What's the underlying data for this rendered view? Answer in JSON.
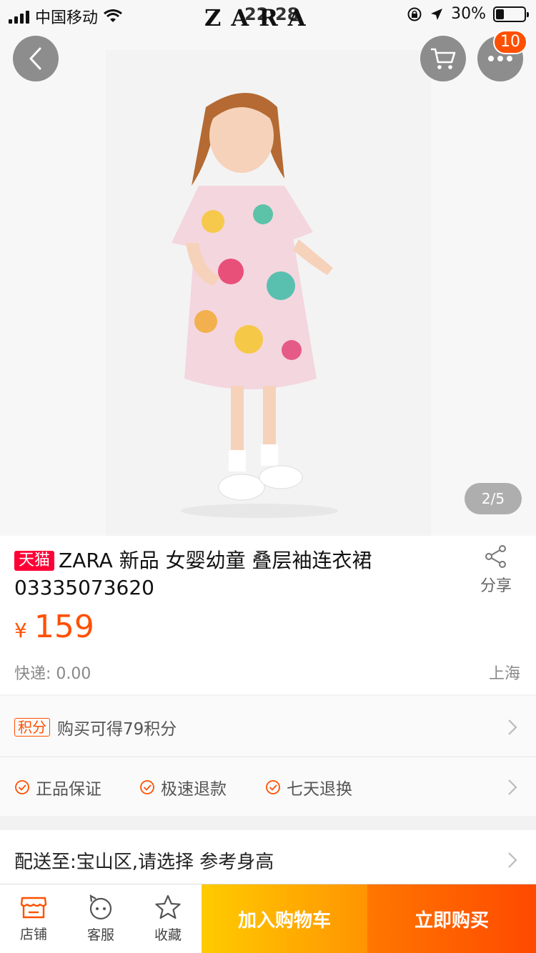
{
  "status_bar": {
    "carrier": "中国移动",
    "brand": "ZARA",
    "time": "22:28",
    "battery_percent_text": "30%",
    "battery_level": 0.3
  },
  "header": {
    "cart_badge": "10"
  },
  "gallery": {
    "pager": "2/5"
  },
  "product": {
    "tag": "天猫",
    "title": "ZARA 新品 女婴幼童 叠层袖连衣裙 03335073620",
    "share_label": "分享",
    "currency": "¥",
    "price": "159",
    "shipping": "快递: 0.00",
    "location": "上海"
  },
  "services": {
    "points_tag": "积分",
    "points_text": "购买可得79积分",
    "guarantees": [
      "正品保证",
      "极速退款",
      "七天退换"
    ]
  },
  "delivery": {
    "text": "配送至:宝山区,请选择 参考身高"
  },
  "bottom_bar": {
    "store": "店铺",
    "service": "客服",
    "favorite": "收藏",
    "add_to_cart": "加入购物车",
    "buy_now": "立即购买"
  },
  "colors": {
    "accent": "#ff5000",
    "tmall_red": "#ff0036",
    "cart_gradient": [
      "#ffcb00",
      "#ff9402"
    ],
    "buy_gradient": [
      "#ff7700",
      "#ff4900"
    ]
  },
  "icons": {
    "back": "chevron-left-icon",
    "cart": "cart-icon",
    "more": "more-dots-icon",
    "share": "share-icon",
    "store": "store-icon",
    "service": "service-face-icon",
    "favorite": "star-icon"
  }
}
